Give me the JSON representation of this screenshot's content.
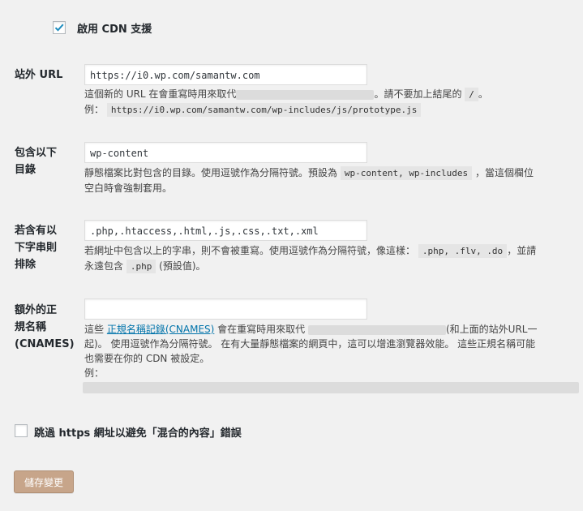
{
  "cdn": {
    "enabled": true,
    "label": "啟用 CDN 支援"
  },
  "offsite_url": {
    "label": "站外 URL",
    "value": "https://i0.wp.com/samantw.com",
    "desc_prefix": "這個新的 URL 在會重寫時用來取代",
    "desc_suffix": "。請不要加上結尾的",
    "slash_code": "/",
    "desc_end": "。",
    "example_label": "例：",
    "example_code": "https://i0.wp.com/samantw.com/wp-includes/js/prototype.js"
  },
  "include_dirs": {
    "label_line1": "包含以下",
    "label_line2": "目錄",
    "value": "wp-content",
    "desc_part1": "靜態檔案比對包含的目錄。使用逗號作為分隔符號。預設為",
    "default_code": "wp-content, wp-includes",
    "desc_part2": "，當這個欄位",
    "desc_line2": "空白時會強制套用。"
  },
  "exclude": {
    "label_line1": "若含有以",
    "label_line2": "下字串則",
    "label_line3": "排除",
    "value": ".php,.htaccess,.html,.js,.css,.txt,.xml",
    "desc_part1": "若網址中包含以上的字串，則不會被重寫。使用逗號作為分隔符號，像這樣：",
    "example_code": ".php, .flv, .do",
    "desc_part2": "，並請",
    "desc_line2_prefix": "永遠包含",
    "php_code": ".php",
    "desc_line2_suffix": "(預設值)。"
  },
  "cnames": {
    "label_line1": "額外的正",
    "label_line2": "規名稱",
    "label_line3": "(CNAMES)",
    "value": "",
    "desc_prefix": "這些",
    "link_text": "正規名稱記錄(CNAMES)",
    "desc_mid": "會在重寫時用來取代",
    "desc_after_blur": "(和上面的站外URL一",
    "desc_line2": "起)。 使用逗號作為分隔符號。 在有大量靜態檔案的網頁中，這可以增進瀏覽器效能。 這些正規名稱可能",
    "desc_line3": "也需要在你的 CDN 被設定。",
    "example_label": "例："
  },
  "skip_https": {
    "enabled": false,
    "label": "跳過 https 網址以避免「混合的內容」錯誤"
  },
  "save_button": "儲存變更"
}
